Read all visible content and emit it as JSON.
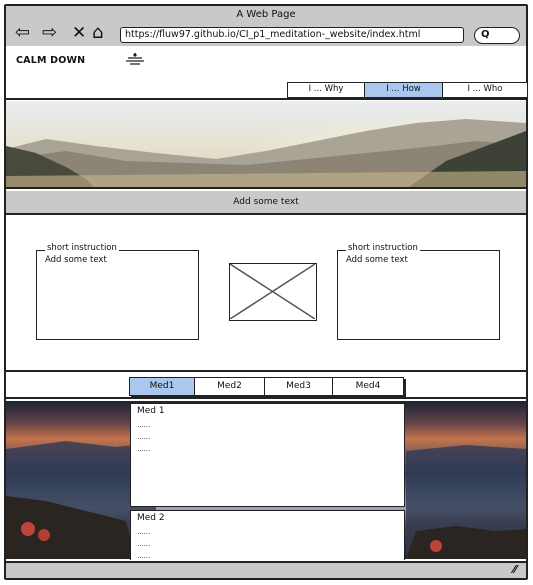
{
  "browser": {
    "title": "A Web Page",
    "url": "https://fluw97.github.io/CI_p1_meditation-_website/index.html",
    "nav_icons": [
      "back-arrow-icon",
      "forward-arrow-icon",
      "close-icon",
      "home-icon"
    ],
    "search_icon": "search-icon"
  },
  "site": {
    "brand": "CALM DOWN",
    "logo_icon": "meditation-icon",
    "nav": [
      {
        "label": "I ... Why",
        "active": false
      },
      {
        "label": "I ... How",
        "active": true
      },
      {
        "label": "I ... Who",
        "active": false
      }
    ]
  },
  "hero": {
    "image": "mountain-landscape-image"
  },
  "band": {
    "text": "Add some text"
  },
  "instructions": {
    "left": {
      "title": "short instruction",
      "text": "Add some text"
    },
    "right": {
      "title": "short instruction",
      "text": "Add some text"
    },
    "image_placeholder": "image-placeholder-icon"
  },
  "meditation": {
    "tabs": [
      {
        "label": "Med1",
        "active": true
      },
      {
        "label": "Med2",
        "active": false
      },
      {
        "label": "Med3",
        "active": false
      },
      {
        "label": "Med4",
        "active": false
      }
    ],
    "panels": [
      {
        "title": "Med 1",
        "lines": [
          "......",
          "......",
          "......"
        ]
      },
      {
        "title": "Med 2",
        "lines": [
          "......",
          "......",
          "......"
        ]
      }
    ]
  },
  "colors": {
    "active_tab": "#a9c7ef",
    "chrome": "#c9c9c9"
  }
}
